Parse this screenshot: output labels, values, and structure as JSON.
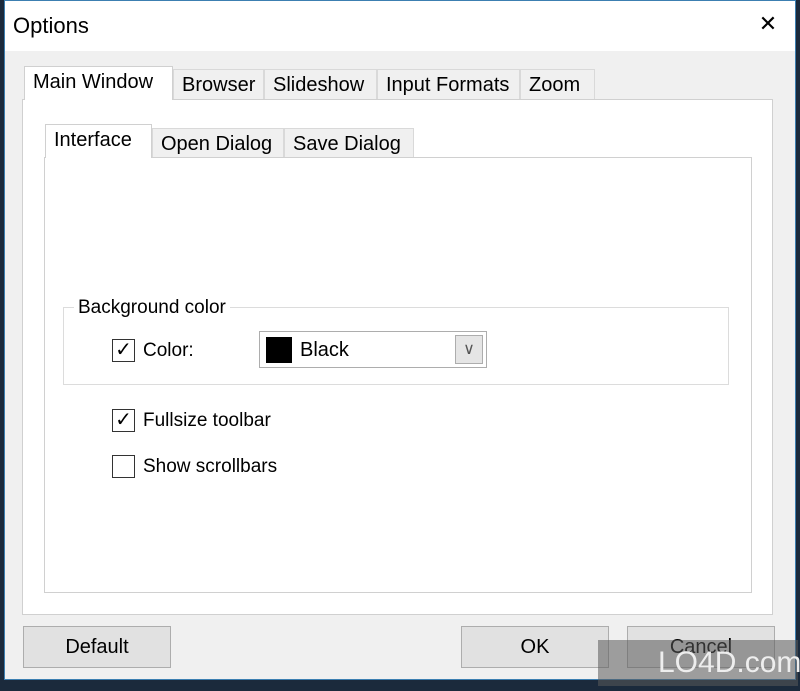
{
  "window": {
    "title": "Options",
    "close_glyph": "✕"
  },
  "main_tabs": [
    {
      "label": "Main Window",
      "active": true
    },
    {
      "label": "Browser"
    },
    {
      "label": "Slideshow"
    },
    {
      "label": "Input Formats"
    },
    {
      "label": "Zoom"
    }
  ],
  "sub_tabs": [
    {
      "label": "Interface",
      "active": true
    },
    {
      "label": "Open Dialog"
    },
    {
      "label": "Save Dialog"
    }
  ],
  "background_color": {
    "group_label": "Background color",
    "color_label": "Color:",
    "color_checked": true,
    "selected": "Black",
    "swatch": "#000000"
  },
  "fullsize_toolbar": {
    "label": "Fullsize toolbar",
    "checked": true
  },
  "show_scrollbars": {
    "label": "Show scrollbars",
    "checked": false
  },
  "buttons": {
    "default": "Default",
    "ok": "OK",
    "cancel": "Cancel"
  },
  "watermark": "LO4D.com"
}
